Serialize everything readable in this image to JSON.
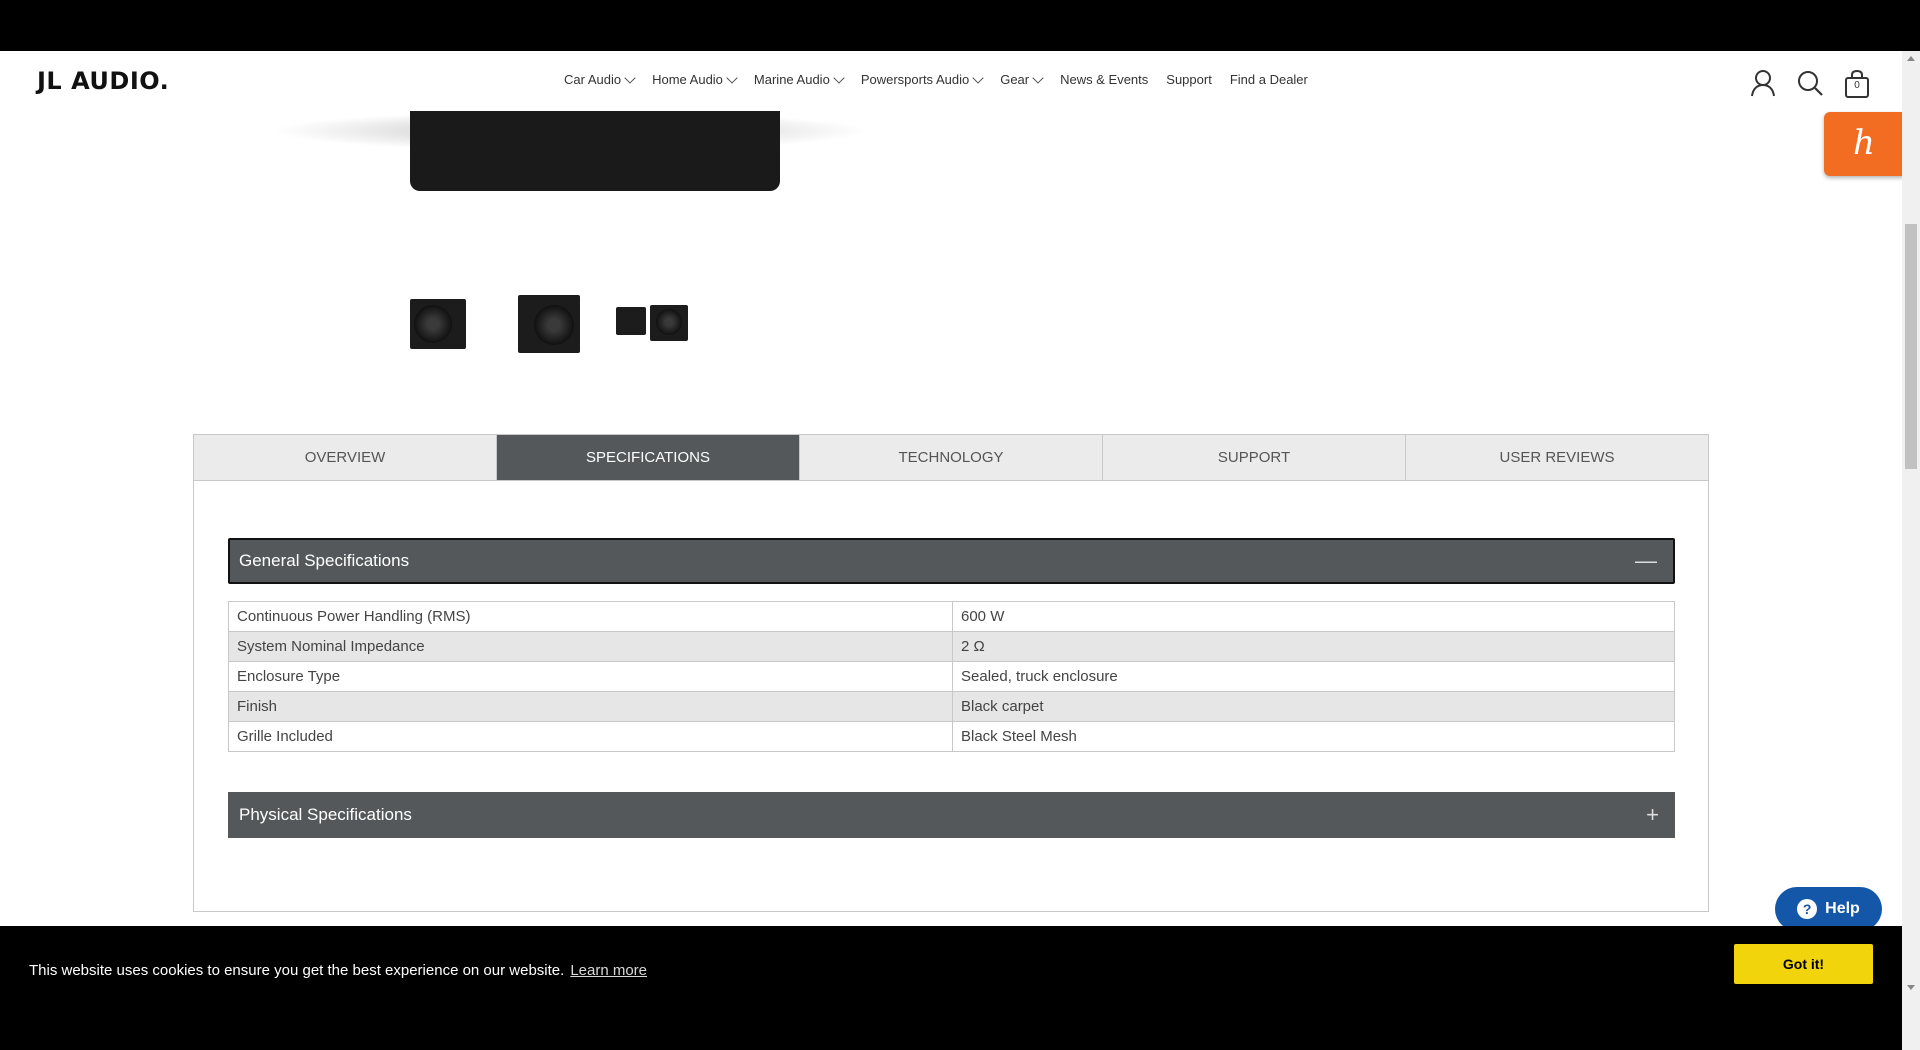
{
  "header": {
    "logo": "JL AUDIO.",
    "nav": [
      {
        "label": "Car Audio",
        "dropdown": true
      },
      {
        "label": "Home Audio",
        "dropdown": true
      },
      {
        "label": "Marine Audio",
        "dropdown": true
      },
      {
        "label": "Powersports Audio",
        "dropdown": true
      },
      {
        "label": "Gear",
        "dropdown": true
      },
      {
        "label": "News & Events",
        "dropdown": false
      },
      {
        "label": "Support",
        "dropdown": false
      },
      {
        "label": "Find a Dealer",
        "dropdown": false
      }
    ],
    "cart_count": "0",
    "icons": [
      "user-icon",
      "search-icon",
      "cart-icon"
    ]
  },
  "honey": {
    "glyph": "h"
  },
  "tabs": [
    {
      "label": "OVERVIEW",
      "active": false
    },
    {
      "label": "SPECIFICATIONS",
      "active": true
    },
    {
      "label": "TECHNOLOGY",
      "active": false
    },
    {
      "label": "SUPPORT",
      "active": false
    },
    {
      "label": "USER REVIEWS",
      "active": false
    }
  ],
  "general_specs": {
    "title": "General Specifications",
    "toggle": "—",
    "rows": [
      {
        "label": "Continuous Power Handling (RMS)",
        "value": "600 W"
      },
      {
        "label": "System Nominal Impedance",
        "value": "2 Ω"
      },
      {
        "label": "Enclosure Type",
        "value": "Sealed, truck enclosure"
      },
      {
        "label": "Finish",
        "value": "Black carpet"
      },
      {
        "label": "Grille Included",
        "value": "Black Steel Mesh"
      }
    ]
  },
  "physical_specs": {
    "title": "Physical Specifications",
    "toggle": "+"
  },
  "help": {
    "label": "Help",
    "glyph": "?"
  },
  "cookie": {
    "text": "This website uses cookies to ensure you get the best experience on our website.",
    "link": "Learn more",
    "button": "Got it!"
  },
  "colors": {
    "accent_dark": "#54585a",
    "honey": "#f26c21",
    "help": "#1457a8",
    "cookie_button": "#f2d40d"
  }
}
